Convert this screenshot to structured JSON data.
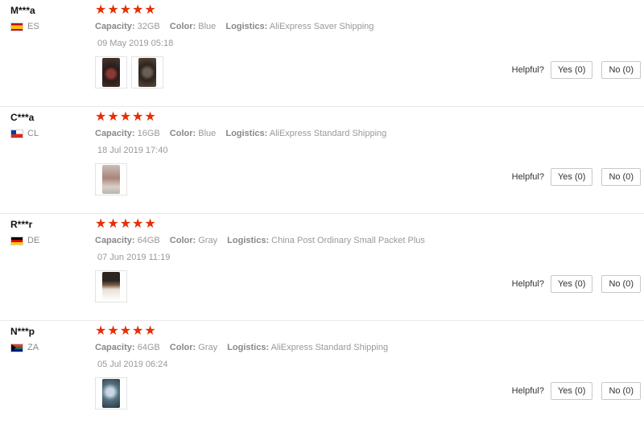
{
  "reviews": [
    {
      "user": "M***a",
      "country_code": "ES",
      "stars": "★★★★★",
      "capacity_label": "Capacity:",
      "capacity": "32GB",
      "color_label": "Color:",
      "color": "Blue",
      "logistics_label": "Logistics:",
      "logistics": "AliExpress Saver Shipping",
      "date": "09 May 2019 05:18",
      "helpful_label": "Helpful?",
      "yes_label": "Yes (0)",
      "no_label": "No (0)"
    },
    {
      "user": "C***a",
      "country_code": "CL",
      "stars": "★★★★★",
      "capacity_label": "Capacity:",
      "capacity": "16GB",
      "color_label": "Color:",
      "color": "Blue",
      "logistics_label": "Logistics:",
      "logistics": "AliExpress Standard Shipping",
      "date": "18 Jul 2019 17:40",
      "helpful_label": "Helpful?",
      "yes_label": "Yes (0)",
      "no_label": "No (0)"
    },
    {
      "user": "R***r",
      "country_code": "DE",
      "stars": "★★★★★",
      "capacity_label": "Capacity:",
      "capacity": "64GB",
      "color_label": "Color:",
      "color": "Gray",
      "logistics_label": "Logistics:",
      "logistics": "China Post Ordinary Small Packet Plus",
      "date": "07 Jun 2019 11:19",
      "helpful_label": "Helpful?",
      "yes_label": "Yes (0)",
      "no_label": "No (0)"
    },
    {
      "user": "N***p",
      "country_code": "ZA",
      "stars": "★★★★★",
      "capacity_label": "Capacity:",
      "capacity": "64GB",
      "color_label": "Color:",
      "color": "Gray",
      "logistics_label": "Logistics:",
      "logistics": "AliExpress Standard Shipping",
      "date": "05 Jul 2019 06:24",
      "helpful_label": "Helpful?",
      "yes_label": "Yes (0)",
      "no_label": "No (0)"
    }
  ],
  "colors": {
    "star": "#e62e04",
    "divider": "#e8e8e8",
    "muted_text": "#999999"
  },
  "icons": {
    "star": "star-icon",
    "flag": "flag-icon",
    "photo": "review-photo-thumbnail"
  }
}
